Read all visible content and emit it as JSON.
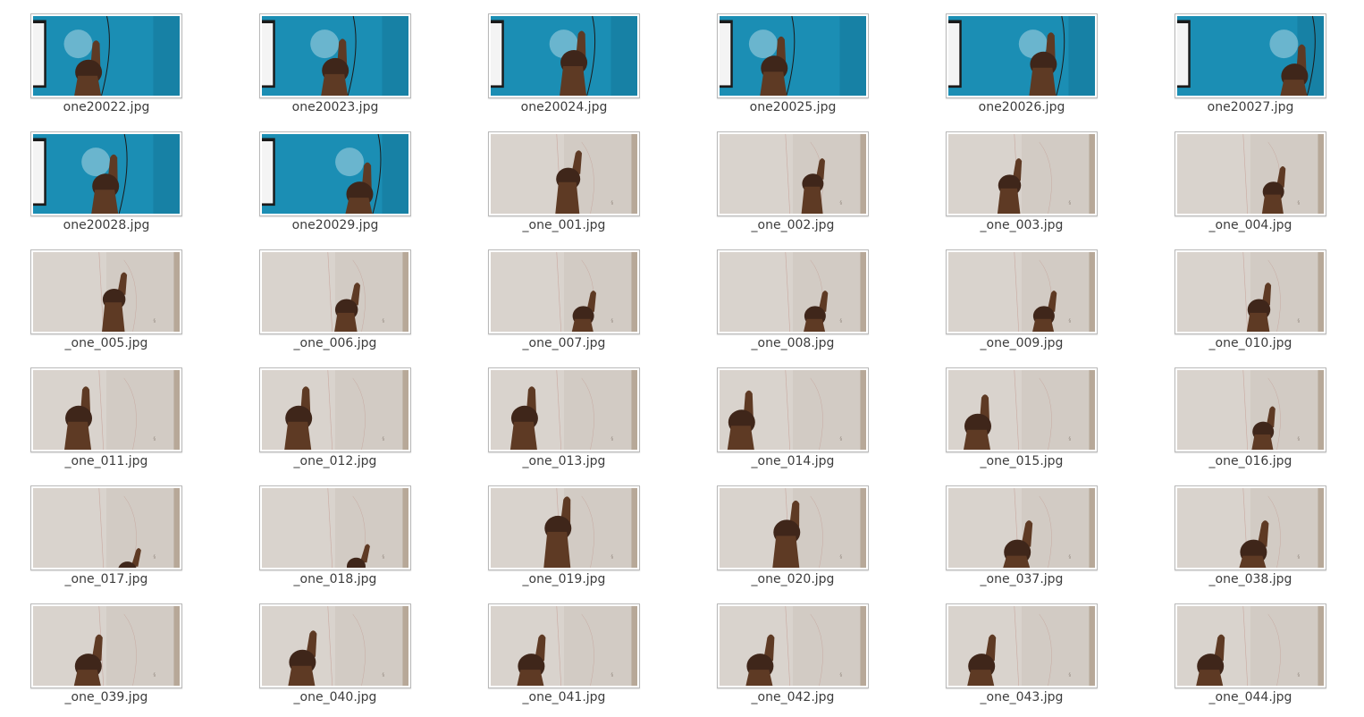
{
  "colors": {
    "blue_wall": "#1b8eb4",
    "blue_wall_dark": "#137396",
    "grey_wall": "#d2cbc4",
    "grey_wall_light": "#e0dbd5",
    "skin": "#5e3a24",
    "skin_dark": "#3f261a",
    "label_text": "#3c3c3c"
  },
  "files": [
    {
      "name": "one20022.jpg",
      "thumb": "blue-monitor-hand"
    },
    {
      "name": "one20023.jpg",
      "thumb": "blue-monitor-hand"
    },
    {
      "name": "one20024.jpg",
      "thumb": "blue-monitor-hand"
    },
    {
      "name": "one20025.jpg",
      "thumb": "blue-monitor-hand"
    },
    {
      "name": "one20026.jpg",
      "thumb": "blue-monitor-hand"
    },
    {
      "name": "one20027.jpg",
      "thumb": "blue-monitor-hand"
    },
    {
      "name": "one20028.jpg",
      "thumb": "blue-monitor-hand"
    },
    {
      "name": "one20029.jpg",
      "thumb": "blue-monitor-hand"
    },
    {
      "name": "_one_001.jpg",
      "thumb": "grey-wall-hand"
    },
    {
      "name": "_one_002.jpg",
      "thumb": "grey-wall-hand"
    },
    {
      "name": "_one_003.jpg",
      "thumb": "grey-wall-hand"
    },
    {
      "name": "_one_004.jpg",
      "thumb": "grey-wall-hand"
    },
    {
      "name": "_one_005.jpg",
      "thumb": "grey-wall-hand"
    },
    {
      "name": "_one_006.jpg",
      "thumb": "grey-wall-hand"
    },
    {
      "name": "_one_007.jpg",
      "thumb": "grey-wall-hand"
    },
    {
      "name": "_one_008.jpg",
      "thumb": "grey-wall-hand"
    },
    {
      "name": "_one_009.jpg",
      "thumb": "grey-wall-hand"
    },
    {
      "name": "_one_010.jpg",
      "thumb": "grey-wall-hand"
    },
    {
      "name": "_one_011.jpg",
      "thumb": "grey-wall-hand"
    },
    {
      "name": "_one_012.jpg",
      "thumb": "grey-wall-hand"
    },
    {
      "name": "_one_013.jpg",
      "thumb": "grey-wall-hand"
    },
    {
      "name": "_one_014.jpg",
      "thumb": "grey-wall-hand"
    },
    {
      "name": "_one_015.jpg",
      "thumb": "grey-wall-hand"
    },
    {
      "name": "_one_016.jpg",
      "thumb": "grey-wall-hand"
    },
    {
      "name": "_one_017.jpg",
      "thumb": "grey-wall-hand"
    },
    {
      "name": "_one_018.jpg",
      "thumb": "grey-wall-hand"
    },
    {
      "name": "_one_019.jpg",
      "thumb": "grey-wall-hand"
    },
    {
      "name": "_one_020.jpg",
      "thumb": "grey-wall-hand"
    },
    {
      "name": "_one_037.jpg",
      "thumb": "grey-wall-hand"
    },
    {
      "name": "_one_038.jpg",
      "thumb": "grey-wall-hand"
    },
    {
      "name": "_one_039.jpg",
      "thumb": "grey-wall-hand"
    },
    {
      "name": "_one_040.jpg",
      "thumb": "grey-wall-hand"
    },
    {
      "name": "_one_041.jpg",
      "thumb": "grey-wall-hand"
    },
    {
      "name": "_one_042.jpg",
      "thumb": "grey-wall-hand"
    },
    {
      "name": "_one_043.jpg",
      "thumb": "grey-wall-hand"
    },
    {
      "name": "_one_044.jpg",
      "thumb": "grey-wall-hand"
    }
  ]
}
